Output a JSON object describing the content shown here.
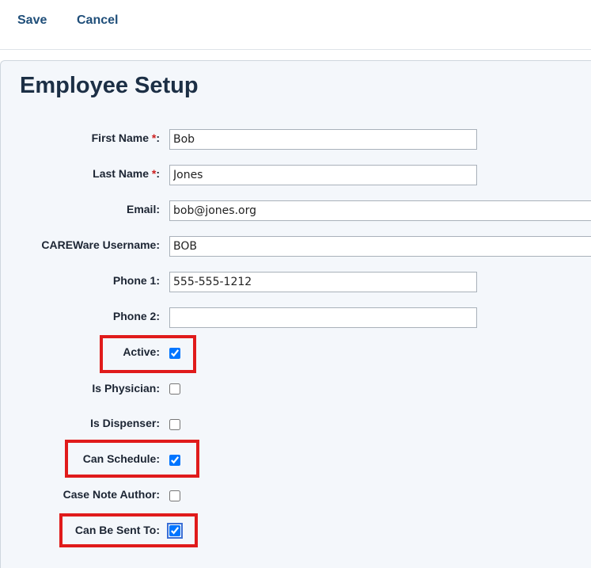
{
  "toolbar": {
    "save_label": "Save",
    "cancel_label": "Cancel"
  },
  "page": {
    "title": "Employee Setup"
  },
  "form": {
    "first_name": {
      "label": "First Name",
      "required_mark": "*",
      "suffix": ":",
      "value": "Bob"
    },
    "last_name": {
      "label": "Last Name",
      "required_mark": "*",
      "suffix": ":",
      "value": "Jones"
    },
    "email": {
      "label": "Email:",
      "value": "bob@jones.org"
    },
    "username": {
      "label": "CAREWare Username:",
      "value": "BOB"
    },
    "phone1": {
      "label": "Phone 1:",
      "value": "555-555-1212"
    },
    "phone2": {
      "label": "Phone 2:",
      "value": ""
    },
    "active": {
      "label": "Active:",
      "checked": true,
      "highlighted": true
    },
    "is_physician": {
      "label": "Is Physician:",
      "checked": false
    },
    "is_dispenser": {
      "label": "Is Dispenser:",
      "checked": false
    },
    "can_schedule": {
      "label": "Can Schedule:",
      "checked": true,
      "highlighted": true
    },
    "case_note_author": {
      "label": "Case Note Author:",
      "checked": false
    },
    "can_be_sent_to": {
      "label": "Can Be Sent To:",
      "checked": true,
      "highlighted": true
    }
  },
  "colors": {
    "highlight": "#e01b1b",
    "accent": "#1f4e79",
    "required": "#cc1f1f"
  }
}
